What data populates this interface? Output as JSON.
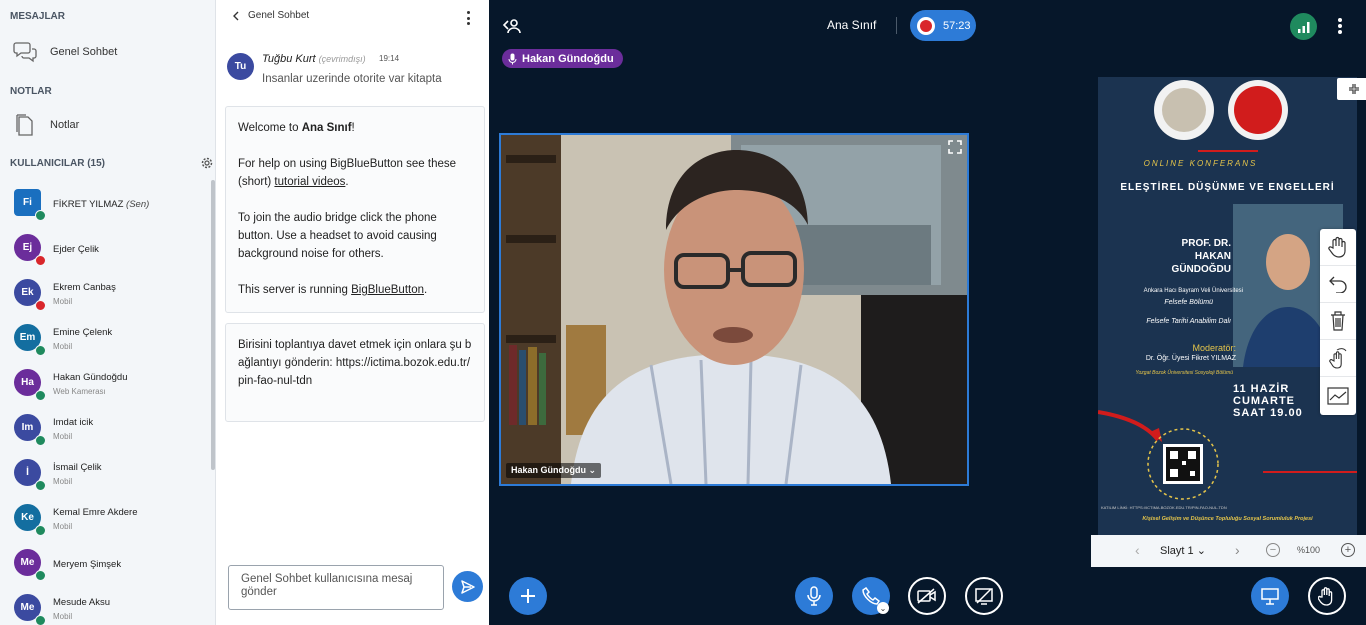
{
  "sidebar": {
    "messages_title": "MESAJLAR",
    "public_chat": "Genel Sohbet",
    "notes_title": "NOTLAR",
    "notes": "Notlar",
    "users_title": "KULLANICILAR (15)",
    "users": [
      {
        "initials": "Fi",
        "name": "FİKRET YILMAZ",
        "suffix": "(Sen)",
        "status": "",
        "color": "#1a6fbf",
        "square": true,
        "badge": "#1f8a5e"
      },
      {
        "initials": "Ej",
        "name": "Ejder Çelik",
        "suffix": "",
        "status": "",
        "color": "#6b2d9b",
        "square": false,
        "badge": "#d9262b"
      },
      {
        "initials": "Ek",
        "name": "Ekrem Canbaş",
        "suffix": "",
        "status": "Mobil",
        "color": "#3b4aa0",
        "square": false,
        "badge": "#d9262b"
      },
      {
        "initials": "Em",
        "name": "Emine Çelenk",
        "suffix": "",
        "status": "Mobil",
        "color": "#136ea0",
        "square": false,
        "badge": "#1f8a5e"
      },
      {
        "initials": "Ha",
        "name": "Hakan Gündoğdu",
        "suffix": "",
        "status": "Web Kamerası",
        "color": "#6b2d9b",
        "square": false,
        "badge": "#1f8a5e"
      },
      {
        "initials": "Im",
        "name": "Imdat icik",
        "suffix": "",
        "status": "Mobil",
        "color": "#3b4aa0",
        "square": false,
        "badge": "#1f8a5e"
      },
      {
        "initials": "İ",
        "name": "İsmail Çelik",
        "suffix": "",
        "status": "Mobil",
        "color": "#3b4aa0",
        "square": false,
        "badge": "#1f8a5e"
      },
      {
        "initials": "Ke",
        "name": "Kemal Emre Akdere",
        "suffix": "",
        "status": "Mobil",
        "color": "#136ea0",
        "square": false,
        "badge": "#1f8a5e"
      },
      {
        "initials": "Me",
        "name": "Meryem Şimşek",
        "suffix": "",
        "status": "",
        "color": "#6b2d9b",
        "square": false,
        "badge": "#1f8a5e"
      },
      {
        "initials": "Me",
        "name": "Mesude Aksu",
        "suffix": "",
        "status": "Mobil",
        "color": "#3b4aa0",
        "square": false,
        "badge": "#1f8a5e"
      }
    ]
  },
  "chat": {
    "header": "Genel Sohbet",
    "message": {
      "initials": "Tu",
      "author": "Tuğbu Kurt",
      "author_status": "(çevrimdışı)",
      "time": "19:14",
      "text": "Insanlar uzerinde otorite var kitapta"
    },
    "welcome": {
      "line1_prefix": "Welcome to ",
      "line1_room": "Ana Sınıf",
      "line1_suffix": "!",
      "line2_prefix": "For help on using BigBlueButton see these (short) ",
      "line2_link": "tutorial videos",
      "line2_suffix": ".",
      "line3": "To join the audio bridge click the phone button. Use a headset to avoid causing background noise for others.",
      "line4_prefix": "This server is running ",
      "line4_link": "BigBlueButton",
      "line4_suffix": "."
    },
    "invite": "Birisini toplantıya davet etmek için onlara şu bağlantıyı gönderin: https://ictima.bozok.edu.tr/pin-fao-nul-tdn",
    "input_placeholder": "Genel Sohbet kullanıcısına mesaj gönder"
  },
  "main": {
    "room_name": "Ana Sınıf",
    "recording_time": "57:23",
    "talking": "Hakan Gündoğdu",
    "video_name": "Hakan Gündoğdu",
    "slide_label": "Slayt 1",
    "zoom": "%100"
  },
  "slide": {
    "subtitle": "ONLINE KONFERANS",
    "title": "ELEŞTİREL DÜŞÜNME VE ENGELLERİ",
    "speaker": "PROF. DR. HAKAN GÜNDOĞDU",
    "uni": "Ankara Hacı Bayram Veli Üniversitesi",
    "dept1": "Felsefe Bölümü",
    "dept2": "Felsefe Tarihi Anabilim Dalı",
    "mod_title": "Moderatör:",
    "mod_name": "Dr. Öğr. Üyesi Fikret YILMAZ",
    "mod_uni": "Yozgat Bozok Üniversitesi Sosyoloji Bölümü",
    "date1": "11 HAZİR",
    "date2": "CUMARTE",
    "date3": "SAAT 19.00",
    "link": "KATILIM LİNKİ: HTTPS://ICTIMA.BOZOK.EDU.TR/PIN-FAO-NUL-TDN",
    "footer": "Kişisel Gelişim ve Düşünce Topluluğu Sosyal Sorumluluk Projesi"
  }
}
